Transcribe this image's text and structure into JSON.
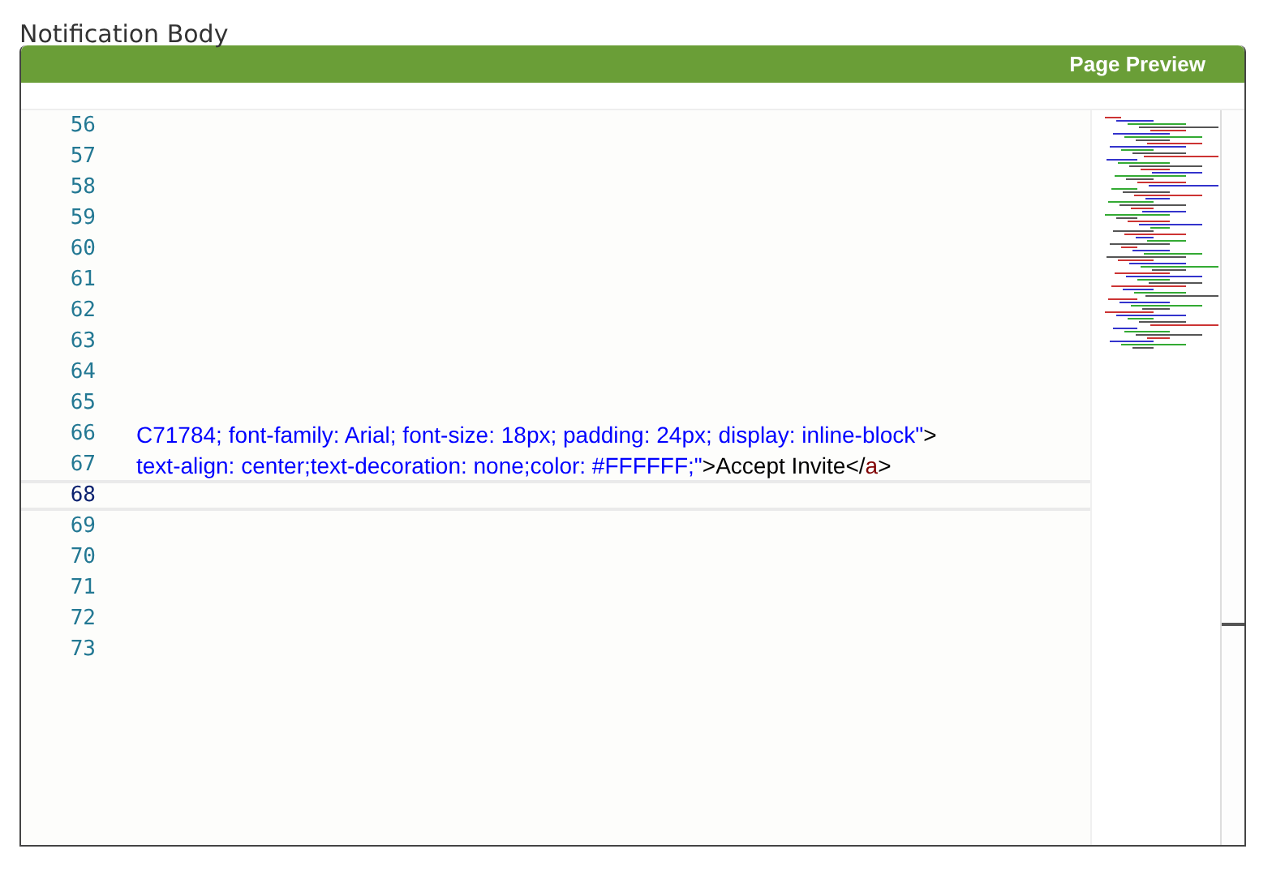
{
  "title": "Notification Body",
  "panel": {
    "header": "Page Preview"
  },
  "editor": {
    "lines": [
      {
        "number": "56",
        "active": false
      },
      {
        "number": "57",
        "active": false
      },
      {
        "number": "58",
        "active": false
      },
      {
        "number": "59",
        "active": false
      },
      {
        "number": "60",
        "active": false
      },
      {
        "number": "61",
        "active": false
      },
      {
        "number": "62",
        "active": false
      },
      {
        "number": "63",
        "active": false
      },
      {
        "number": "64",
        "active": false
      },
      {
        "number": "65",
        "active": false
      },
      {
        "number": "66",
        "active": false,
        "tokens": [
          {
            "kind": "value",
            "text": "C71784; font-family: Arial; font-size: 18px; padding: 24px; display: inline-block\""
          },
          {
            "kind": "text",
            "text": ">"
          }
        ]
      },
      {
        "number": "67",
        "active": false,
        "tokens": [
          {
            "kind": "value",
            "text": "text-align: center;text-decoration: none;color: #FFFFFF;\""
          },
          {
            "kind": "text",
            "text": ">Accept Invite</"
          },
          {
            "kind": "tag",
            "text": "a"
          },
          {
            "kind": "text",
            "text": ">"
          }
        ]
      },
      {
        "number": "68",
        "active": true
      },
      {
        "number": "69",
        "active": false
      },
      {
        "number": "70",
        "active": false
      },
      {
        "number": "71",
        "active": false
      },
      {
        "number": "72",
        "active": false
      },
      {
        "number": "73",
        "active": false
      }
    ]
  }
}
